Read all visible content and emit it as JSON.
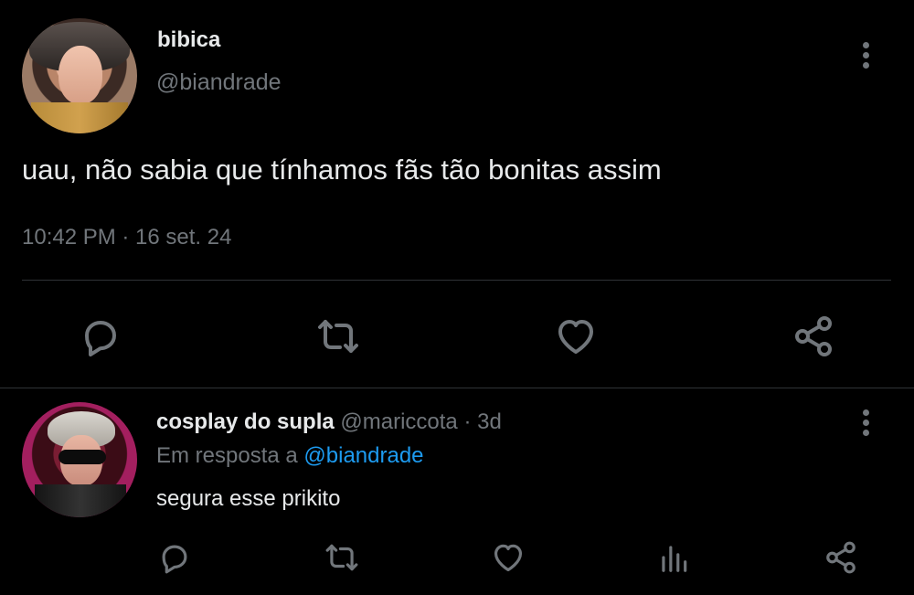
{
  "tweet": {
    "display_name": "bibica",
    "handle": "@biandrade",
    "text": "uau, não sabia que tínhamos fãs tão bonitas assim",
    "timestamp": "10:42 PM · 16 set. 24",
    "icons": {
      "more": "more-vertical-icon",
      "reply": "comment-icon",
      "retweet": "retweet-icon",
      "like": "heart-icon",
      "share": "share-icon"
    }
  },
  "reply": {
    "display_name": "cosplay do supla",
    "handle": "@mariccota",
    "time_sep": "·",
    "time": "3d",
    "replying_to_prefix": "Em resposta a",
    "replying_to_handle": "@biandrade",
    "text": "segura esse prikito",
    "icons": {
      "more": "more-vertical-icon",
      "reply": "comment-icon",
      "retweet": "retweet-icon",
      "like": "heart-icon",
      "views": "analytics-icon",
      "share": "share-icon"
    }
  },
  "colors": {
    "background": "#000000",
    "text": "#e7e9ea",
    "muted": "#71767b",
    "link": "#1d9bf0",
    "divider": "#2f3336"
  }
}
